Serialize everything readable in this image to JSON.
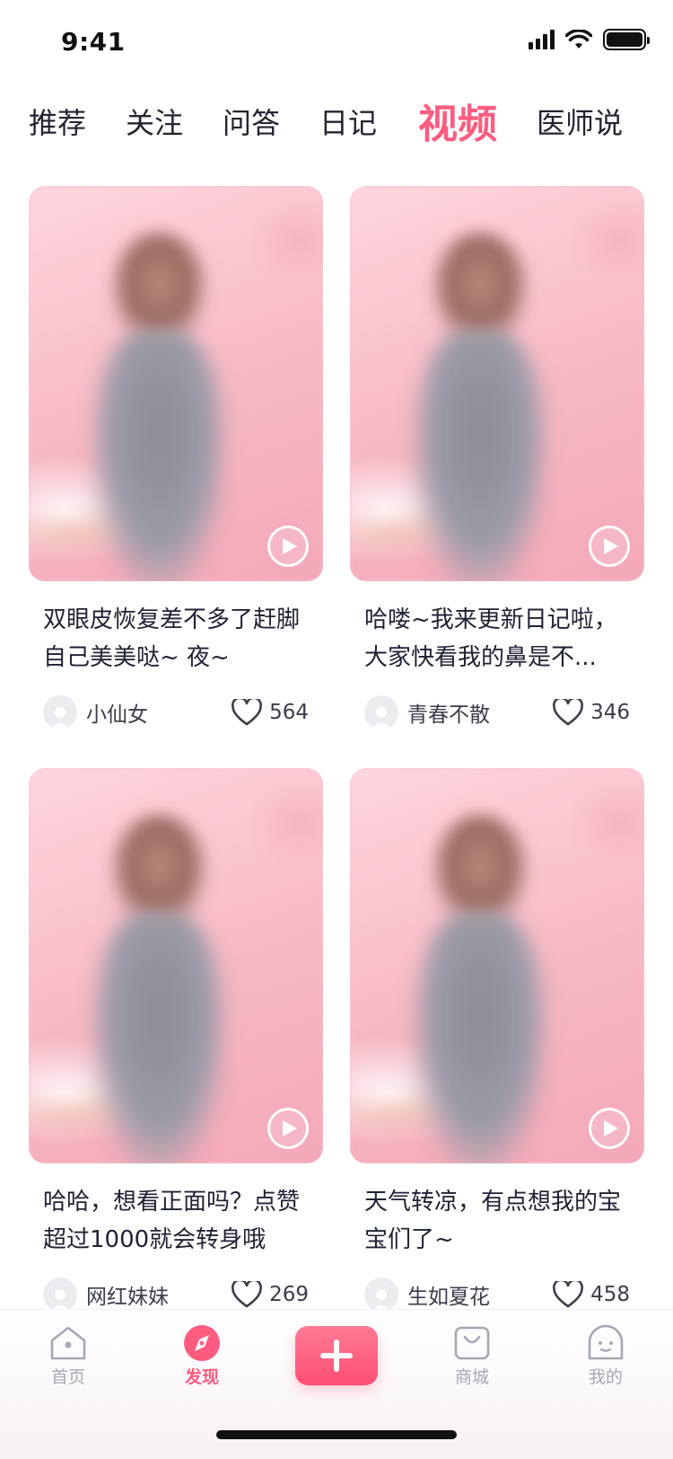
{
  "status_bar": {
    "time": "9:41"
  },
  "tabs": [
    {
      "label": "推荐",
      "active": false
    },
    {
      "label": "关注",
      "active": false
    },
    {
      "label": "问答",
      "active": false
    },
    {
      "label": "日记",
      "active": false
    },
    {
      "label": "视频",
      "active": true
    },
    {
      "label": "医师说",
      "active": false
    }
  ],
  "cards": [
    {
      "title": "双眼皮恢复差不多了赶脚自己美美哒~ 夜~",
      "author": "小仙女",
      "likes": "564"
    },
    {
      "title": "哈喽~我来更新日记啦，大家快看我的鼻是不...",
      "author": "青春不散",
      "likes": "346"
    },
    {
      "title": "哈哈，想看正面吗？点赞超过1000就会转身哦",
      "author": "网红妹妹",
      "likes": "269"
    },
    {
      "title": "天气转凉，有点想我的宝宝们了~",
      "author": "生如夏花",
      "likes": "458"
    }
  ],
  "bottom_nav": [
    {
      "label": "首页",
      "icon": "home-icon",
      "active": false
    },
    {
      "label": "发现",
      "icon": "compass-icon",
      "active": true
    },
    {
      "label": "",
      "icon": "plus-icon",
      "active": false
    },
    {
      "label": "商城",
      "icon": "shopping-bag-icon",
      "active": false
    },
    {
      "label": "我的",
      "icon": "smiley-icon",
      "active": false
    }
  ],
  "colors": {
    "accent": "#fd5c80",
    "text_primary": "#1f2233",
    "text_muted": "#a5a8b3",
    "add_button": "#fc4e73"
  }
}
